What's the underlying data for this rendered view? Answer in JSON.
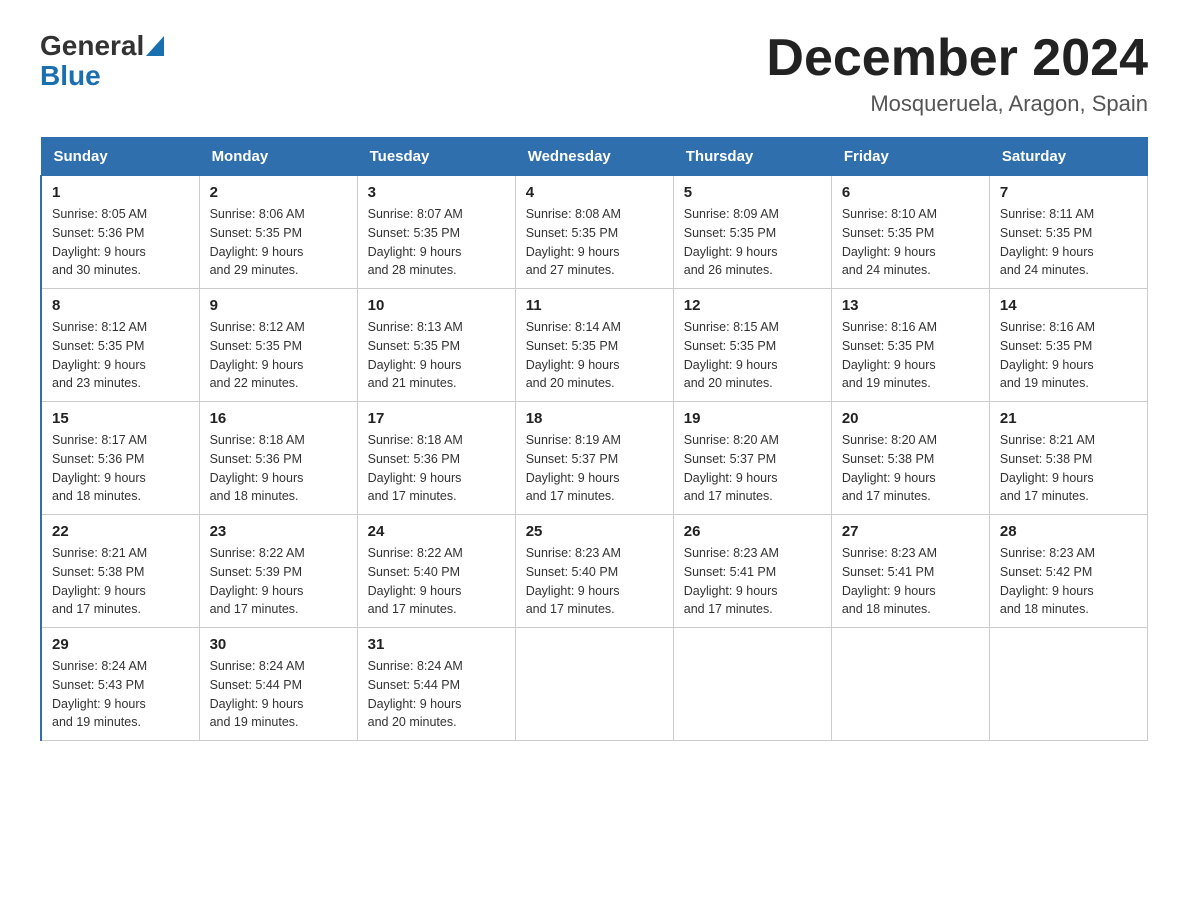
{
  "logo": {
    "general": "General",
    "blue": "Blue"
  },
  "header": {
    "month_year": "December 2024",
    "location": "Mosqueruela, Aragon, Spain"
  },
  "weekdays": [
    "Sunday",
    "Monday",
    "Tuesday",
    "Wednesday",
    "Thursday",
    "Friday",
    "Saturday"
  ],
  "weeks": [
    [
      {
        "day": "1",
        "sunrise": "8:05 AM",
        "sunset": "5:36 PM",
        "daylight": "9 hours and 30 minutes."
      },
      {
        "day": "2",
        "sunrise": "8:06 AM",
        "sunset": "5:35 PM",
        "daylight": "9 hours and 29 minutes."
      },
      {
        "day": "3",
        "sunrise": "8:07 AM",
        "sunset": "5:35 PM",
        "daylight": "9 hours and 28 minutes."
      },
      {
        "day": "4",
        "sunrise": "8:08 AM",
        "sunset": "5:35 PM",
        "daylight": "9 hours and 27 minutes."
      },
      {
        "day": "5",
        "sunrise": "8:09 AM",
        "sunset": "5:35 PM",
        "daylight": "9 hours and 26 minutes."
      },
      {
        "day": "6",
        "sunrise": "8:10 AM",
        "sunset": "5:35 PM",
        "daylight": "9 hours and 24 minutes."
      },
      {
        "day": "7",
        "sunrise": "8:11 AM",
        "sunset": "5:35 PM",
        "daylight": "9 hours and 24 minutes."
      }
    ],
    [
      {
        "day": "8",
        "sunrise": "8:12 AM",
        "sunset": "5:35 PM",
        "daylight": "9 hours and 23 minutes."
      },
      {
        "day": "9",
        "sunrise": "8:12 AM",
        "sunset": "5:35 PM",
        "daylight": "9 hours and 22 minutes."
      },
      {
        "day": "10",
        "sunrise": "8:13 AM",
        "sunset": "5:35 PM",
        "daylight": "9 hours and 21 minutes."
      },
      {
        "day": "11",
        "sunrise": "8:14 AM",
        "sunset": "5:35 PM",
        "daylight": "9 hours and 20 minutes."
      },
      {
        "day": "12",
        "sunrise": "8:15 AM",
        "sunset": "5:35 PM",
        "daylight": "9 hours and 20 minutes."
      },
      {
        "day": "13",
        "sunrise": "8:16 AM",
        "sunset": "5:35 PM",
        "daylight": "9 hours and 19 minutes."
      },
      {
        "day": "14",
        "sunrise": "8:16 AM",
        "sunset": "5:35 PM",
        "daylight": "9 hours and 19 minutes."
      }
    ],
    [
      {
        "day": "15",
        "sunrise": "8:17 AM",
        "sunset": "5:36 PM",
        "daylight": "9 hours and 18 minutes."
      },
      {
        "day": "16",
        "sunrise": "8:18 AM",
        "sunset": "5:36 PM",
        "daylight": "9 hours and 18 minutes."
      },
      {
        "day": "17",
        "sunrise": "8:18 AM",
        "sunset": "5:36 PM",
        "daylight": "9 hours and 17 minutes."
      },
      {
        "day": "18",
        "sunrise": "8:19 AM",
        "sunset": "5:37 PM",
        "daylight": "9 hours and 17 minutes."
      },
      {
        "day": "19",
        "sunrise": "8:20 AM",
        "sunset": "5:37 PM",
        "daylight": "9 hours and 17 minutes."
      },
      {
        "day": "20",
        "sunrise": "8:20 AM",
        "sunset": "5:38 PM",
        "daylight": "9 hours and 17 minutes."
      },
      {
        "day": "21",
        "sunrise": "8:21 AM",
        "sunset": "5:38 PM",
        "daylight": "9 hours and 17 minutes."
      }
    ],
    [
      {
        "day": "22",
        "sunrise": "8:21 AM",
        "sunset": "5:38 PM",
        "daylight": "9 hours and 17 minutes."
      },
      {
        "day": "23",
        "sunrise": "8:22 AM",
        "sunset": "5:39 PM",
        "daylight": "9 hours and 17 minutes."
      },
      {
        "day": "24",
        "sunrise": "8:22 AM",
        "sunset": "5:40 PM",
        "daylight": "9 hours and 17 minutes."
      },
      {
        "day": "25",
        "sunrise": "8:23 AM",
        "sunset": "5:40 PM",
        "daylight": "9 hours and 17 minutes."
      },
      {
        "day": "26",
        "sunrise": "8:23 AM",
        "sunset": "5:41 PM",
        "daylight": "9 hours and 17 minutes."
      },
      {
        "day": "27",
        "sunrise": "8:23 AM",
        "sunset": "5:41 PM",
        "daylight": "9 hours and 18 minutes."
      },
      {
        "day": "28",
        "sunrise": "8:23 AM",
        "sunset": "5:42 PM",
        "daylight": "9 hours and 18 minutes."
      }
    ],
    [
      {
        "day": "29",
        "sunrise": "8:24 AM",
        "sunset": "5:43 PM",
        "daylight": "9 hours and 19 minutes."
      },
      {
        "day": "30",
        "sunrise": "8:24 AM",
        "sunset": "5:44 PM",
        "daylight": "9 hours and 19 minutes."
      },
      {
        "day": "31",
        "sunrise": "8:24 AM",
        "sunset": "5:44 PM",
        "daylight": "9 hours and 20 minutes."
      },
      null,
      null,
      null,
      null
    ]
  ],
  "labels": {
    "sunrise": "Sunrise:",
    "sunset": "Sunset:",
    "daylight": "Daylight:"
  }
}
